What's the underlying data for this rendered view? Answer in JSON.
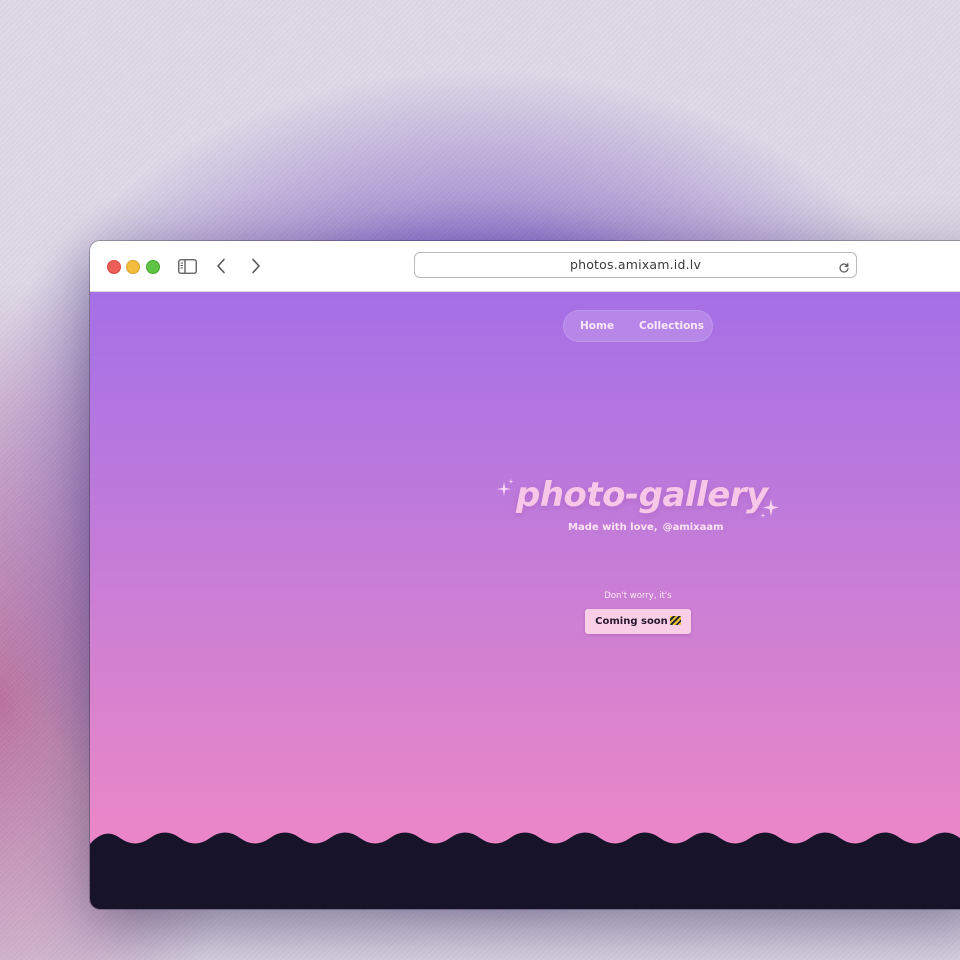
{
  "browser": {
    "url": "photos.amixam.id.lv"
  },
  "nav": {
    "items": [
      "Home",
      "Collections"
    ]
  },
  "hero": {
    "title": "photo-gallery",
    "subtitle_prefix": "Made with love,",
    "subtitle_handle": "@amixaam"
  },
  "notice": {
    "small_text": "Don't worry, it's",
    "button_label": "Coming soon"
  },
  "colors": {
    "gradient_top": "#a56fe6",
    "gradient_bottom": "#ef88c6",
    "footer": "#17142a",
    "title_pink": "#f8c6e6",
    "button_bg": "#f8cfe6"
  },
  "icons": {
    "traffic_lights": [
      "close-icon",
      "minimize-icon",
      "zoom-icon"
    ],
    "toolbar": [
      "sidebar-icon",
      "back-icon",
      "forward-icon",
      "reload-icon"
    ],
    "decor": [
      "sparkle-icon",
      "construction-icon"
    ]
  }
}
